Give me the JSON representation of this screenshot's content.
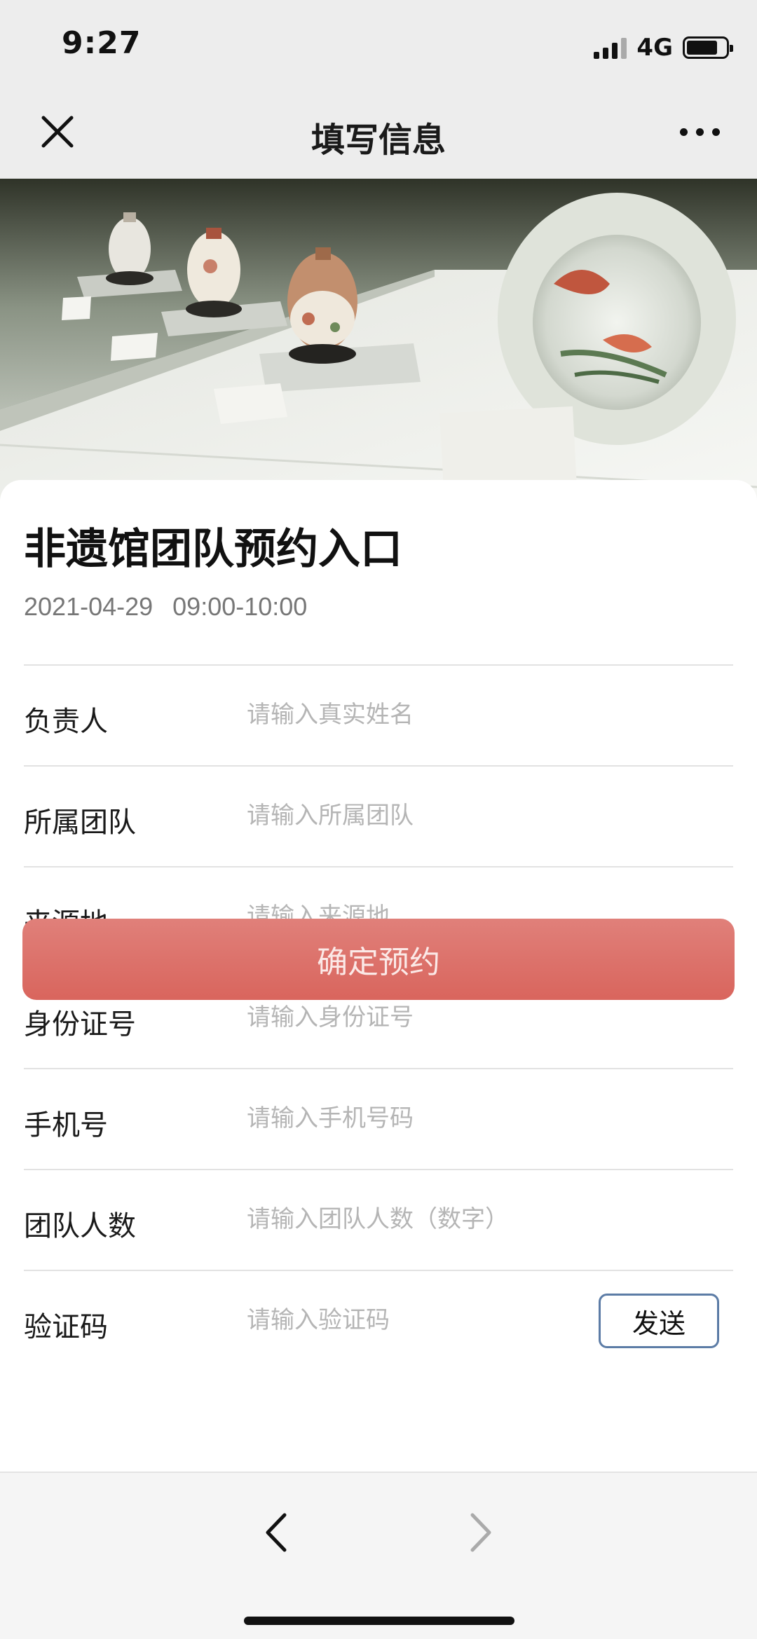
{
  "status_bar": {
    "time": "9:27",
    "network": "4G",
    "battery_level": 0.8
  },
  "nav": {
    "title": "填写信息",
    "close_icon": "close-icon",
    "more_icon": "more-icon"
  },
  "banner": {
    "description_icon": "exhibit-photo"
  },
  "card": {
    "title": "非遗馆团队预约入口",
    "date": "2021-04-29",
    "time_slot": "09:00-10:00"
  },
  "form": {
    "fields": [
      {
        "label": "负责人",
        "placeholder": "请输入真实姓名",
        "value": ""
      },
      {
        "label": "所属团队",
        "placeholder": "请输入所属团队",
        "value": ""
      },
      {
        "label": "来源地",
        "placeholder": "请输入来源地",
        "value": ""
      },
      {
        "label": "身份证号",
        "placeholder": "请输入身份证号",
        "value": ""
      },
      {
        "label": "手机号",
        "placeholder": "请输入手机号码",
        "value": ""
      },
      {
        "label": "团队人数",
        "placeholder": "请输入团队人数（数字）",
        "value": ""
      },
      {
        "label": "验证码",
        "placeholder": "请输入验证码",
        "value": ""
      }
    ],
    "send_label": "发送",
    "submit_label": "确定预约"
  },
  "colors": {
    "accent": "#d9655d",
    "send_border": "#5c7ca6",
    "background": "#ededed"
  },
  "toolbar": {
    "back_icon": "chevron-left-icon",
    "forward_icon": "chevron-right-icon"
  }
}
